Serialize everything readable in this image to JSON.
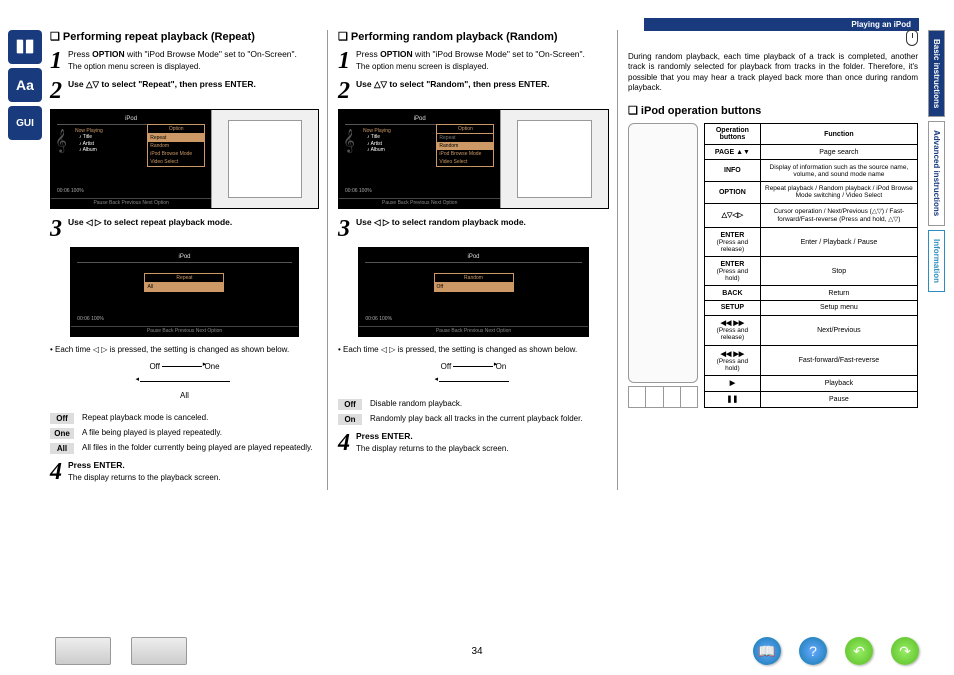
{
  "header": {
    "breadcrumb": "Playing an iPod"
  },
  "sidebar_right": {
    "items": [
      "Basic instructions",
      "Advanced instructions",
      "Information"
    ]
  },
  "page_number": "34",
  "col1": {
    "title": "Performing repeat playback (Repeat)",
    "step1": {
      "text_a": "Press ",
      "text_b": "OPTION",
      "text_c": " with \"iPod Browse Mode\" set to \"On-Screen\".",
      "sub": "The option menu screen is displayed."
    },
    "step2": {
      "text": "Use △▽ to select \"Repeat\", then press ENTER."
    },
    "screen1": {
      "header": "iPod",
      "optionbox": {
        "h": "Option",
        "items": [
          "Repeat",
          "Random",
          "iPod Browse Mode",
          "Video Select"
        ],
        "selected": 0
      },
      "now": "Now Playing",
      "list": [
        "♪ Title",
        "♪ Artist",
        "♪ Album"
      ],
      "progress": "00:06    100%",
      "footer": "Pause  Back   Previous  Next   Option"
    },
    "step3": {
      "text": "Use ◁ ▷ to select repeat playback mode."
    },
    "screen2": {
      "header": "iPod",
      "repeat_h": "Repeat",
      "rows": [
        "All"
      ],
      "progress": "00:06    100%",
      "footer": "Pause  Back   Previous  Next   Option"
    },
    "cycle_note": "• Each time ◁ ▷ is pressed, the setting is changed as shown below.",
    "cycle": {
      "a": "Off",
      "b": "One",
      "c": "All"
    },
    "defs": [
      {
        "tag": "Off",
        "txt": "Repeat playback mode is canceled."
      },
      {
        "tag": "One",
        "txt": "A file being played is played repeatedly."
      },
      {
        "tag": "All",
        "txt": "All files in the folder currently being played are played repeatedly."
      }
    ],
    "step4": {
      "text": "Press ENTER.",
      "sub": "The display returns to the playback screen."
    }
  },
  "col2": {
    "title": "Performing random playback (Random)",
    "step1": {
      "text_a": "Press ",
      "text_b": "OPTION",
      "text_c": " with \"iPod Browse Mode\" set to \"On-Screen\".",
      "sub": "The option menu screen is displayed."
    },
    "step2": {
      "text": "Use △▽ to select \"Random\", then press ENTER."
    },
    "screen1": {
      "header": "iPod",
      "optionbox": {
        "h": "Option",
        "items": [
          "Repeat",
          "Random",
          "iPod Browse Mode",
          "Video Select"
        ],
        "selected": 1
      },
      "now": "Now Playing",
      "list": [
        "♪ Title",
        "♪ Artist",
        "♪ Album"
      ],
      "progress": "00:06    100%",
      "footer": "Pause  Back   Previous  Next   Option"
    },
    "step3": {
      "text": "Use ◁ ▷ to select random playback mode."
    },
    "screen2": {
      "header": "iPod",
      "repeat_h": "Random",
      "rows": [
        "Off"
      ],
      "progress": "00:06    100%",
      "footer": "Pause  Back   Previous  Next   Option"
    },
    "cycle_note": "• Each time ◁ ▷ is pressed, the setting is changed as shown below.",
    "cycle": {
      "a": "Off",
      "b": "On"
    },
    "defs": [
      {
        "tag": "Off",
        "txt": "Disable random playback."
      },
      {
        "tag": "On",
        "txt": "Randomly play back all tracks in the current playback folder."
      }
    ],
    "step4": {
      "text": "Press ENTER.",
      "sub": "The display returns to the playback screen."
    }
  },
  "col3": {
    "intro": "During random playback, each time playback of a track is completed, another track is randomly selected for playback from tracks in the folder. Therefore, it's possible that you may hear a track played back more than once during random playback.",
    "title": "iPod operation buttons",
    "table": {
      "headers": [
        "Operation buttons",
        "Function"
      ],
      "rows": [
        {
          "btn": "PAGE ▲▼",
          "fn": "Page search"
        },
        {
          "btn": "INFO",
          "fn": "Display of information such as the source name, volume, and sound mode name"
        },
        {
          "btn": "OPTION",
          "fn": "Repeat playback / Random playback / iPod Browse Mode switching / Video Select"
        },
        {
          "btn": "△▽◁▷",
          "fn": "Cursor operation / Next/Previous (△▽) / Fast-forward/Fast-reverse (Press and hold, △▽)"
        },
        {
          "btn": "ENTER",
          "sub": "(Press and release)",
          "fn": "Enter / Playback / Pause"
        },
        {
          "btn": "ENTER",
          "sub": "(Press and hold)",
          "fn": "Stop"
        },
        {
          "btn": "BACK",
          "fn": "Return"
        },
        {
          "btn": "SETUP",
          "fn": "Setup menu"
        },
        {
          "btn": "◀◀ ▶▶",
          "sub": "(Press and release)",
          "fn": "Next/Previous"
        },
        {
          "btn": "◀◀ ▶▶",
          "sub": "(Press and hold)",
          "fn": "Fast-forward/Fast-reverse"
        },
        {
          "btn": "▶",
          "fn": "Playback"
        },
        {
          "btn": "❚❚",
          "fn": "Pause"
        }
      ]
    }
  }
}
